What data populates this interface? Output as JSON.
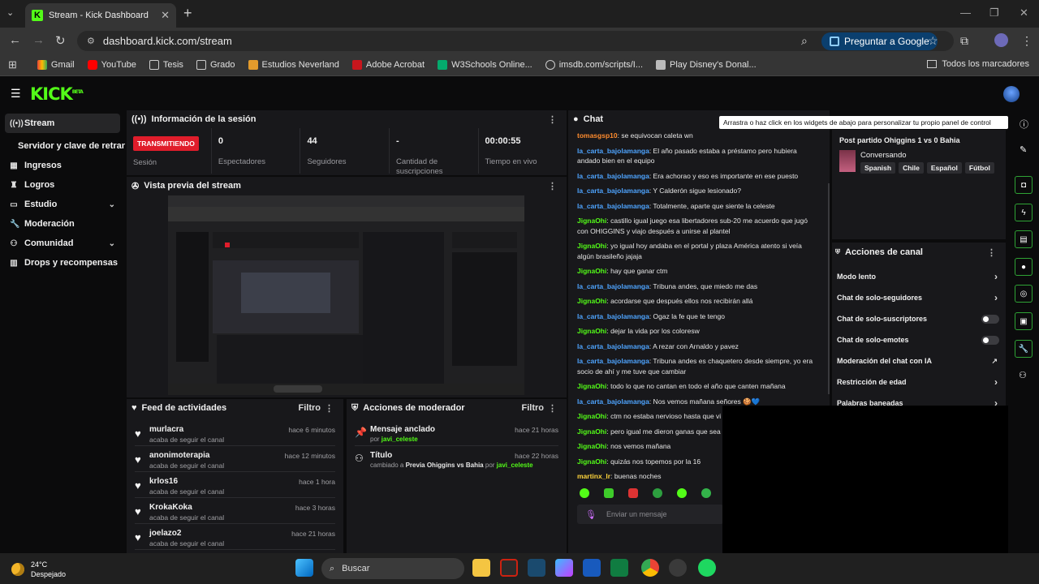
{
  "browser": {
    "tab_title": "Stream - Kick Dashboard",
    "url": "dashboard.kick.com/stream",
    "google_button": "Preguntar a Google",
    "bookmarks": [
      "Gmail",
      "YouTube",
      "Tesis",
      "Grado",
      "Estudios Neverland",
      "Adobe Acrobat",
      "W3Schools Online...",
      "imsdb.com/scripts/I...",
      "Play Disney's Donal..."
    ],
    "all_bookmarks": "Todos los marcadores",
    "colors": {
      "accent": "#53fc18",
      "live": "#e01d2b",
      "panel": "#18181b",
      "link_blue": "#4ea4ff"
    }
  },
  "kick": {
    "logo": "KICK",
    "logo_sup": "BETA"
  },
  "sidebar": {
    "items": [
      {
        "label": "Stream",
        "icon": "broadcast-icon"
      },
      {
        "label": "Servidor y clave de retransmisión",
        "icon": ""
      },
      {
        "label": "Ingresos",
        "icon": "money-icon"
      },
      {
        "label": "Logros",
        "icon": "trophy-icon"
      },
      {
        "label": "Estudio",
        "icon": "studio-icon"
      },
      {
        "label": "Moderación",
        "icon": "wrench-icon"
      },
      {
        "label": "Comunidad",
        "icon": "community-icon"
      },
      {
        "label": "Drops y recompensas",
        "icon": "gift-icon"
      }
    ]
  },
  "session": {
    "title": "Información de la sesión",
    "live_badge": "TRANSMITIENDO",
    "session_label": "Sesión",
    "stats": [
      {
        "value": "0",
        "label": "Espectadores"
      },
      {
        "value": "44",
        "label": "Seguidores"
      },
      {
        "value": "-",
        "label": "Cantidad de suscripciones"
      },
      {
        "value": "00:00:55",
        "label": "Tiempo en vivo"
      }
    ]
  },
  "preview": {
    "title": "Vista previa del stream"
  },
  "activity": {
    "title": "Feed de actividades",
    "filter": "Filtro",
    "items": [
      {
        "user": "murlacra",
        "action": "acaba de seguir el canal",
        "time": "hace 6 minutos"
      },
      {
        "user": "anonimoterapia",
        "action": "acaba de seguir el canal",
        "time": "hace 12 minutos"
      },
      {
        "user": "krlos16",
        "action": "acaba de seguir el canal",
        "time": "hace 1 hora"
      },
      {
        "user": "KrokaKoka",
        "action": "acaba de seguir el canal",
        "time": "hace 3 horas"
      },
      {
        "user": "joelazo2",
        "action": "acaba de seguir el canal",
        "time": "hace 21 horas"
      }
    ]
  },
  "moderator": {
    "title": "Acciones de moderador",
    "filter": "Filtro",
    "items": [
      {
        "title": "Mensaje anclado",
        "prefix": "por",
        "value": "",
        "by_prefix": "",
        "by": "javi_celeste",
        "time": "hace 21 horas"
      },
      {
        "title": "Título",
        "prefix": "cambiado a",
        "value": "Previa Ohiggins vs Bahia",
        "by_prefix": "por",
        "by": "javi_celeste",
        "time": "hace 22 horas"
      }
    ]
  },
  "chat": {
    "title": "Chat",
    "input_placeholder": "Enviar un mensaje",
    "messages": [
      {
        "user": "tomasgsp10",
        "color": "o",
        "text": ": se equivocan caleta wn"
      },
      {
        "user": "la_carta_bajolamanga",
        "color": "b",
        "text": ": El año pasado estaba a préstamo pero hubiera andado bien en el equipo"
      },
      {
        "user": "la_carta_bajolamanga",
        "color": "b",
        "text": ": Era achorao y eso es importante en ese puesto"
      },
      {
        "user": "la_carta_bajolamanga",
        "color": "b",
        "text": ": Y Calderón sigue lesionado?"
      },
      {
        "user": "la_carta_bajolamanga",
        "color": "b",
        "text": ": Totalmente, aparte que siente la celeste"
      },
      {
        "user": "JignaOhi",
        "color": "g",
        "text": ": castillo igual juego esa libertadores sub-20 me acuerdo que jugó con OHIGGINS y viajo después a unirse al plantel"
      },
      {
        "user": "JignaOhi",
        "color": "g",
        "text": ": yo igual hoy andaba en el portal y plaza América atento si veía algún brasileño jajaja"
      },
      {
        "user": "JignaOhi",
        "color": "g",
        "text": ": hay que ganar ctm"
      },
      {
        "user": "la_carta_bajolamanga",
        "color": "b",
        "text": ": Tribuna andes, que miedo me das"
      },
      {
        "user": "JignaOhi",
        "color": "g",
        "text": ": acordarse que después ellos nos recibirán allá"
      },
      {
        "user": "la_carta_bajolamanga",
        "color": "b",
        "text": ": Ogaz la fe que te tengo"
      },
      {
        "user": "JignaOhi",
        "color": "g",
        "text": ": dejar la vida por los coloresw"
      },
      {
        "user": "la_carta_bajolamanga",
        "color": "b",
        "text": ": A rezar con Arnaldo y pavez"
      },
      {
        "user": "la_carta_bajolamanga",
        "color": "b",
        "text": ": Tribuna andes es chaquetero desde siempre, yo era socio de ahí y me tuve que cambiar"
      },
      {
        "user": "JignaOhi",
        "color": "g",
        "text": ": todo lo que no cantan en todo el año que canten mañana"
      },
      {
        "user": "la_carta_bajolamanga",
        "color": "b",
        "text": ": Nos vemos mañana señores 🍪💙"
      },
      {
        "user": "JignaOhi",
        "color": "g",
        "text": ": ctm no estaba nervioso hasta que vi tu"
      },
      {
        "user": "JignaOhi",
        "color": "g",
        "text": ": pero igual me dieron ganas que sea el"
      },
      {
        "user": "JignaOhi",
        "color": "g",
        "text": ": nos vemos mañana"
      },
      {
        "user": "JignaOhi",
        "color": "g",
        "text": ": quizás nos topemos por la 16"
      },
      {
        "user": "martinx_lr",
        "color": "y",
        "text": ": buenas noches"
      }
    ]
  },
  "tooltip": "Arrastra o haz click en los widgets de abajo para personalizar tu propio panel de control",
  "stream_info": {
    "title": "Post partido Ohiggins 1 vs 0 Bahia",
    "category": "Conversando",
    "tags": [
      "Spanish",
      "Chile",
      "Español",
      "Fútbol"
    ]
  },
  "channel_actions": {
    "title": "Acciones de canal",
    "items": [
      {
        "label": "Modo lento",
        "control": "chevron"
      },
      {
        "label": "Chat de solo-seguidores",
        "control": "chevron"
      },
      {
        "label": "Chat de solo-suscriptores",
        "control": "toggle"
      },
      {
        "label": "Chat de solo-emotes",
        "control": "toggle"
      },
      {
        "label": "Moderación del chat con IA",
        "control": "external"
      },
      {
        "label": "Restricción de edad",
        "control": "chevron"
      },
      {
        "label": "Palabras baneadas",
        "control": "chevron"
      }
    ]
  },
  "taskbar": {
    "temp": "24°C",
    "weather": "Despejado",
    "search": "Buscar"
  }
}
